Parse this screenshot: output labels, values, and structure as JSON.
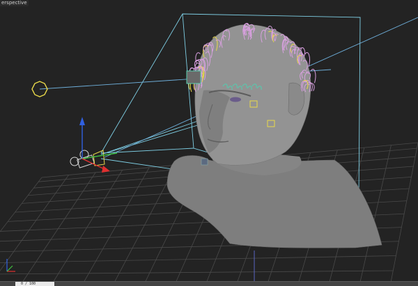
{
  "viewport": {
    "label": "erspective",
    "background": "#232323"
  },
  "colors": {
    "grid": "#4a4a4a",
    "frustum": "#7fd0e6",
    "camera_line": "#6fb0dc",
    "light": "#e8d84a",
    "hair": "#d9a0e0",
    "mesh": "#8c8c8c",
    "axis_x": "#e03030",
    "axis_y": "#40c040",
    "axis_z": "#3060e0"
  },
  "icons": [
    "camera-icon",
    "light-icon",
    "move-gizmo-icon",
    "view-axis-icon",
    "hair-guide-icon"
  ],
  "status": {
    "frame_value": "0 / 100"
  }
}
